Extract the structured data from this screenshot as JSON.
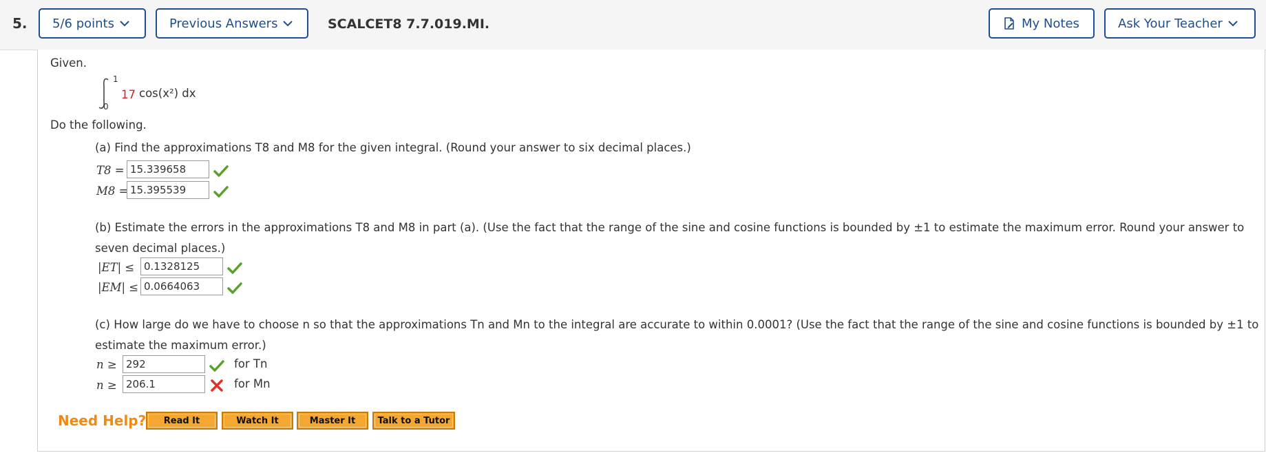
{
  "header": {
    "question_number": "5.",
    "points_label": "5/6 points",
    "previous_answers_label": "Previous Answers",
    "question_code": "SCALCET8 7.7.019.MI.",
    "my_notes_label": "My Notes",
    "ask_teacher_label": "Ask Your Teacher"
  },
  "problem": {
    "given": "Given.",
    "integral": {
      "upper": "1",
      "lower": "0",
      "coefficient": "17",
      "integrand": "cos(x²) dx"
    },
    "instruction": "Do the following.",
    "part_a": {
      "prompt": "(a) Find the approximations T8 and M8 for the given integral. (Round your answer to six decimal places.)",
      "t_label": "T8 =",
      "t_value": "15.339658",
      "m_label": "M8 =",
      "m_value": "15.395539"
    },
    "part_b": {
      "prompt_line1": "(b) Estimate the errors in the approximations T8 and M8 in part (a). (Use the fact that the range of the sine and cosine functions is bounded by ±1 to estimate the maximum error. Round your answer to",
      "prompt_line2": "seven decimal places.)",
      "et_label": "|ET| ≤",
      "et_value": "0.1328125",
      "em_label": "|EM| ≤",
      "em_value": "0.0664063"
    },
    "part_c": {
      "prompt_line1": "(c) How large do we have to choose n so that the approximations Tn and Mn to the integral are accurate to within 0.0001? (Use the fact that the range of the sine and cosine functions is bounded by ±1 to",
      "prompt_line2": "estimate the maximum error.)",
      "n1_label": "n ≥",
      "n1_value": "292",
      "n1_suffix": "for Tn",
      "n2_label": "n ≥",
      "n2_value": "206.1",
      "n2_suffix": "for Mn"
    }
  },
  "help": {
    "title": "Need Help?",
    "buttons": [
      "Read It",
      "Watch It",
      "Master It",
      "Talk to a Tutor"
    ]
  },
  "colors": {
    "accent": "#1e4e8c",
    "correct": "#5aa02c",
    "incorrect": "#e0302a",
    "help_orange": "#f08a12"
  }
}
